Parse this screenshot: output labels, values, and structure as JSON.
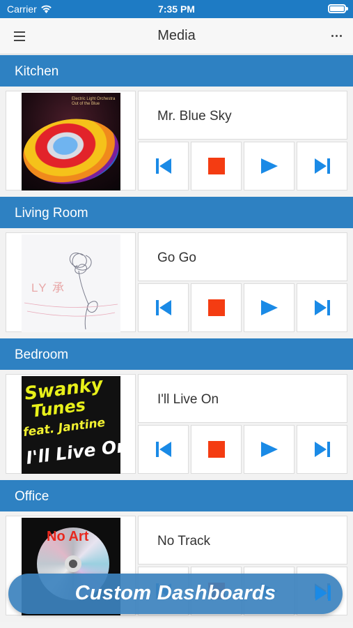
{
  "status": {
    "carrier": "Carrier",
    "time": "7:35 PM"
  },
  "nav": {
    "title": "Media",
    "menu_icon": "menu-icon",
    "more_icon": "more-icon"
  },
  "colors": {
    "accent": "#2e81c2",
    "control_blue": "#1a8ae6",
    "stop_red": "#f43c12"
  },
  "rooms": [
    {
      "name": "Kitchen",
      "track": "Mr. Blue Sky",
      "art": {
        "lines": [
          "Electric Light Orchestra",
          "Out of the Blue"
        ]
      }
    },
    {
      "name": "Living Room",
      "track": "Go Go",
      "art": {
        "text": "LY 承"
      }
    },
    {
      "name": "Bedroom",
      "track": "I'll Live On",
      "art": {
        "lines": [
          "Swanky",
          "Tunes",
          "feat. Jantine",
          "I'll Live On"
        ]
      }
    },
    {
      "name": "Office",
      "track": "No Track",
      "art": {
        "text": "No Art"
      }
    }
  ],
  "controls": [
    "previous-icon",
    "stop-icon",
    "play-icon",
    "next-icon"
  ],
  "banner": {
    "text": "Custom Dashboards"
  }
}
